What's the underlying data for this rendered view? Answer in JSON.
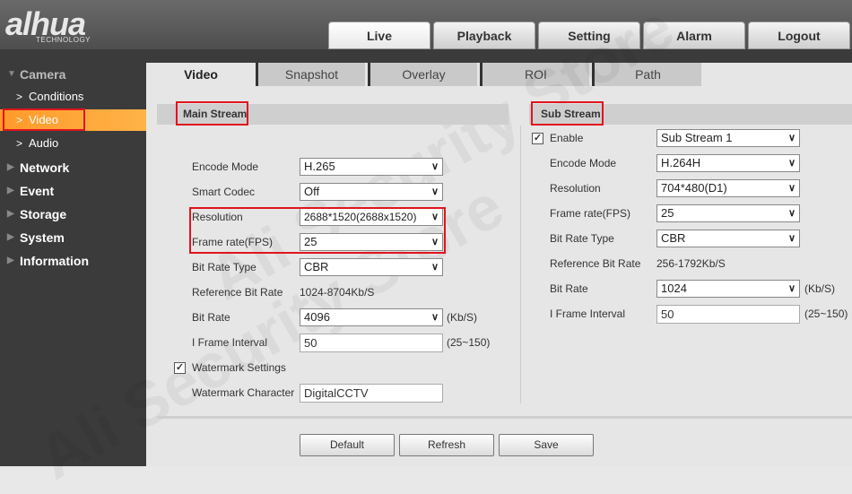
{
  "brand": {
    "logo": "alhua",
    "sub": "TECHNOLOGY"
  },
  "nav": [
    "Live",
    "Playback",
    "Setting",
    "Alarm",
    "Logout"
  ],
  "sidebar": {
    "camera": "Camera",
    "conditions": "Conditions",
    "video": "Video",
    "audio": "Audio",
    "network": "Network",
    "event": "Event",
    "storage": "Storage",
    "system": "System",
    "information": "Information"
  },
  "tabs": [
    "Video",
    "Snapshot",
    "Overlay",
    "ROI",
    "Path"
  ],
  "main": {
    "title": "Main Stream",
    "encode_mode": {
      "label": "Encode Mode",
      "value": "H.265"
    },
    "smart_codec": {
      "label": "Smart Codec",
      "value": "Off"
    },
    "resolution": {
      "label": "Resolution",
      "value": "2688*1520(2688x1520)"
    },
    "frame_rate": {
      "label": "Frame rate(FPS)",
      "value": "25"
    },
    "bit_rate_type": {
      "label": "Bit Rate Type",
      "value": "CBR"
    },
    "ref_bit_rate": {
      "label": "Reference Bit Rate",
      "value": "1024-8704Kb/S"
    },
    "bit_rate": {
      "label": "Bit Rate",
      "value": "4096",
      "unit": "(Kb/S)"
    },
    "iframe": {
      "label": "I Frame Interval",
      "value": "50",
      "range": "(25~150)"
    },
    "watermark": {
      "label": "Watermark Settings",
      "checked": true
    },
    "watermark_char": {
      "label": "Watermark Character",
      "value": "DigitalCCTV"
    }
  },
  "sub": {
    "title": "Sub Stream",
    "enable": {
      "label": "Enable",
      "checked": true,
      "value": "Sub Stream 1"
    },
    "encode_mode": {
      "label": "Encode Mode",
      "value": "H.264H"
    },
    "resolution": {
      "label": "Resolution",
      "value": "704*480(D1)"
    },
    "frame_rate": {
      "label": "Frame rate(FPS)",
      "value": "25"
    },
    "bit_rate_type": {
      "label": "Bit Rate Type",
      "value": "CBR"
    },
    "ref_bit_rate": {
      "label": "Reference Bit Rate",
      "value": "256-1792Kb/S"
    },
    "bit_rate": {
      "label": "Bit Rate",
      "value": "1024",
      "unit": "(Kb/S)"
    },
    "iframe": {
      "label": "I Frame Interval",
      "value": "50",
      "range": "(25~150)"
    }
  },
  "buttons": {
    "default": "Default",
    "refresh": "Refresh",
    "save": "Save"
  },
  "watermark_overlay": "Ali Security Store",
  "colors": {
    "accent": "#ff9a2a",
    "highlight": "#e0141e"
  }
}
